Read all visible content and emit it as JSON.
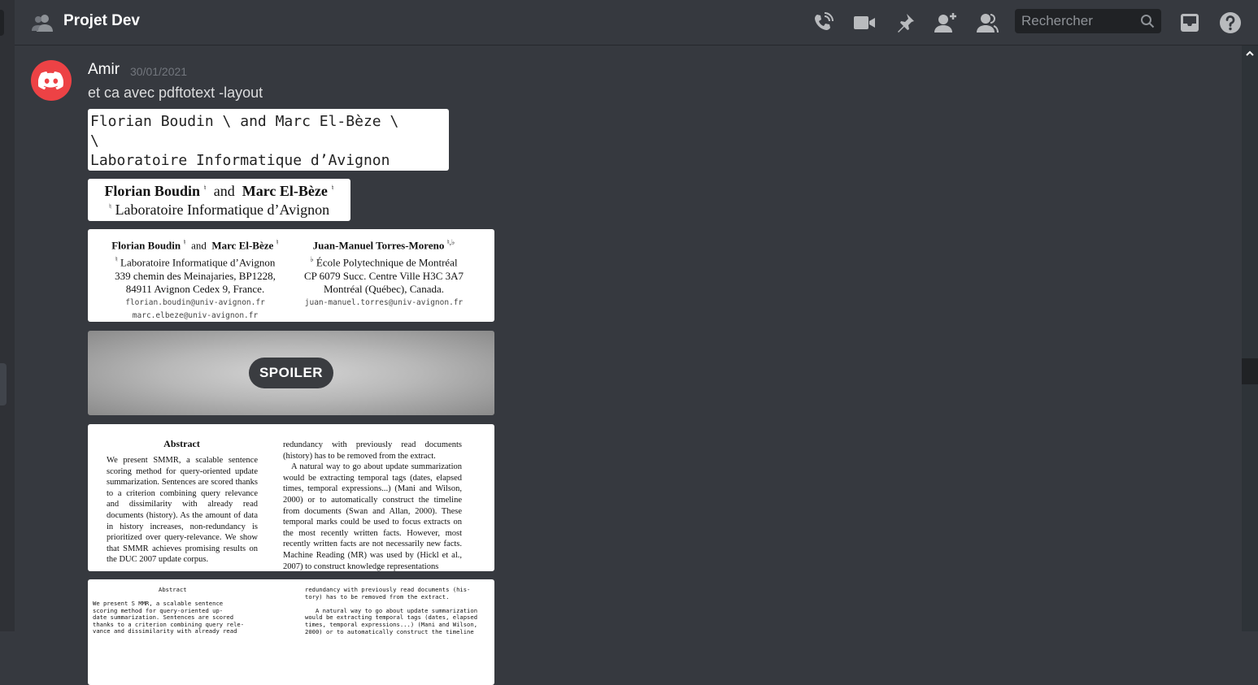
{
  "header": {
    "channel_name": "Projet Dev",
    "search_placeholder": "Rechercher",
    "icons": [
      "voice-call-icon",
      "video-call-icon",
      "pin-icon",
      "add-member-icon",
      "member-list-icon",
      "search-icon",
      "inbox-icon",
      "help-icon"
    ]
  },
  "message": {
    "author": "Amir",
    "timestamp": "30/01/2021",
    "text": "et ca avec pdftotext -layout",
    "avatar_color": "#ed4245"
  },
  "attachments": {
    "mono_extract": {
      "line1": "Florian Boudin \\ and Marc El-Bèze \\",
      "line2": "\\",
      "line3": "Laboratoire Informatique d’Avignon"
    },
    "rendered_header": {
      "author1": "Florian Boudin",
      "sep": "and",
      "author2": "Marc El-Bèze",
      "affil": "Laboratoire Informatique d’Avignon",
      "mark": "♮"
    },
    "paper_header": {
      "left": {
        "authors_a": "Florian Boudin",
        "and": "and",
        "authors_b": "Marc El-Bèze",
        "lab": "Laboratoire Informatique d’Avignon",
        "addr1": "339 chemin des Meinajaries, BP1228,",
        "addr2": "84911 Avignon Cedex 9, France.",
        "email1": "florian.boudin@univ-avignon.fr",
        "email2": "marc.elbeze@univ-avignon.fr"
      },
      "right": {
        "author": "Juan-Manuel Torres-Moreno",
        "marks": "♮,♭",
        "school": "École Polytechnique de Montréal",
        "addr1": "CP 6079 Succ. Centre Ville H3C 3A7",
        "addr2": "Montréal (Québec), Canada.",
        "email": "juan-manuel.torres@univ-avignon.fr"
      }
    },
    "spoiler": {
      "label": "SPOILER"
    },
    "abstract_rendered": {
      "title": "Abstract",
      "body": "We present SMMR, a scalable sentence scoring method for query-oriented update summarization. Sentences are scored thanks to a criterion combining query relevance and dissimilarity with already read documents (history). As the amount of data in history increases, non-redundancy is prioritized over query-relevance. We show that SMMR achieves promising results on the DUC 2007 update corpus.",
      "col2_p1": "redundancy with previously read documents (history) has to be removed from the extract.",
      "col2_p2": "A natural way to go about update summarization would be extracting temporal tags (dates, elapsed times, temporal expressions...) (Mani and Wilson, 2000) or to automatically construct the timeline from documents (Swan and Allan, 2000). These temporal marks could be used to focus extracts on the most recently written facts. However, most recently written facts are not necessarily new facts. Machine Reading (MR) was used by (Hickl et al., 2007) to construct knowledge representations"
    },
    "abstract_text": {
      "title": "Abstract",
      "left_lines": "We present S MMR, a scalable sentence\nscoring method for query-oriented up-\ndate summarization. Sentences are scored\nthanks to a criterion combining query rele-\nvance and dissimilarity with already read",
      "right_lines": "redundancy with previously read documents (his-\ntory) has to be removed from the extract.\n\n   A natural way to go about update summarization\nwould be extracting temporal tags (dates, elapsed\ntimes, temporal expressions...) (Mani and Wilson,\n2000) or to automatically construct the timeline"
    }
  }
}
